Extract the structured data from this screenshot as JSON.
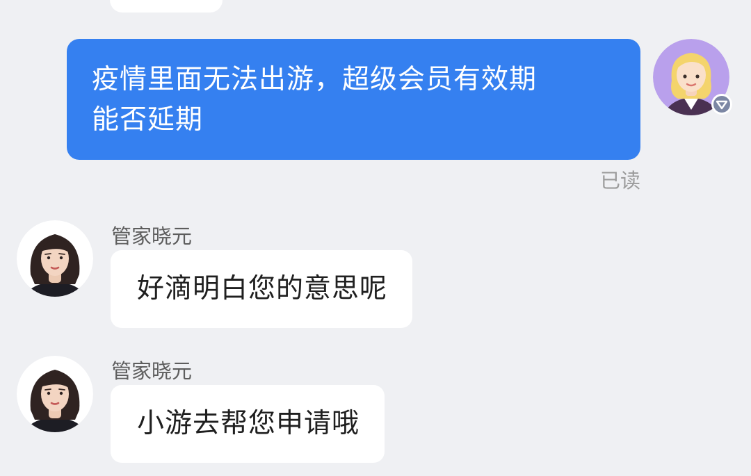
{
  "colors": {
    "background": "#eff0f3",
    "user_bubble": "#3580f0",
    "agent_bubble": "#ffffff",
    "read_status": "#9b9b9b"
  },
  "user_message": {
    "line1": "疫情里面无法出游，超级会员有效期",
    "line2": "能否延期",
    "status": "已读",
    "avatar_icon": "user-avatar-blonde-woman",
    "badge_icon": "member-badge-icon"
  },
  "agent_messages": [
    {
      "sender": "管家晓元",
      "text": "好滴明白您的意思呢",
      "avatar_icon": "agent-avatar-photo"
    },
    {
      "sender": "管家晓元",
      "text": "小游去帮您申请哦",
      "avatar_icon": "agent-avatar-photo"
    }
  ]
}
